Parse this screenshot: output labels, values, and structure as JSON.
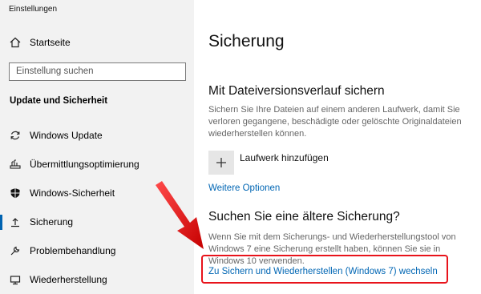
{
  "window": {
    "title": "Einstellungen"
  },
  "sidebar": {
    "home_label": "Startseite",
    "search_placeholder": "Einstellung suchen",
    "section_title": "Update und Sicherheit",
    "items": [
      {
        "label": "Windows Update",
        "icon": "sync-icon"
      },
      {
        "label": "Übermittlungsoptimierung",
        "icon": "delivery-icon"
      },
      {
        "label": "Windows-Sicherheit",
        "icon": "shield-icon"
      },
      {
        "label": "Sicherung",
        "icon": "upload-icon",
        "active": true
      },
      {
        "label": "Problembehandlung",
        "icon": "wrench-icon"
      },
      {
        "label": "Wiederherstellung",
        "icon": "recovery-icon"
      }
    ]
  },
  "main": {
    "title": "Sicherung",
    "file_history": {
      "heading": "Mit Dateiversionsverlauf sichern",
      "description": "Sichern Sie Ihre Dateien auf einem anderen Laufwerk, damit Sie verloren gegangene, beschädigte oder gelöschte Originaldateien wiederherstellen können.",
      "add_drive_label": "Laufwerk hinzufügen",
      "more_options_link": "Weitere Optionen"
    },
    "older_backup": {
      "heading": "Suchen Sie eine ältere Sicherung?",
      "description": "Wenn Sie mit dem Sicherungs- und Wiederherstellungstool von Windows 7 eine Sicherung erstellt haben, können Sie sie in Windows 10 verwenden.",
      "link": "Zu Sichern und Wiederherstellen (Windows 7) wechseln"
    }
  },
  "annotation": {
    "color": "#e8131b"
  },
  "colors": {
    "accent": "#0063b1",
    "link": "#0066b4",
    "sidebar_bg": "#f2f2f2"
  }
}
